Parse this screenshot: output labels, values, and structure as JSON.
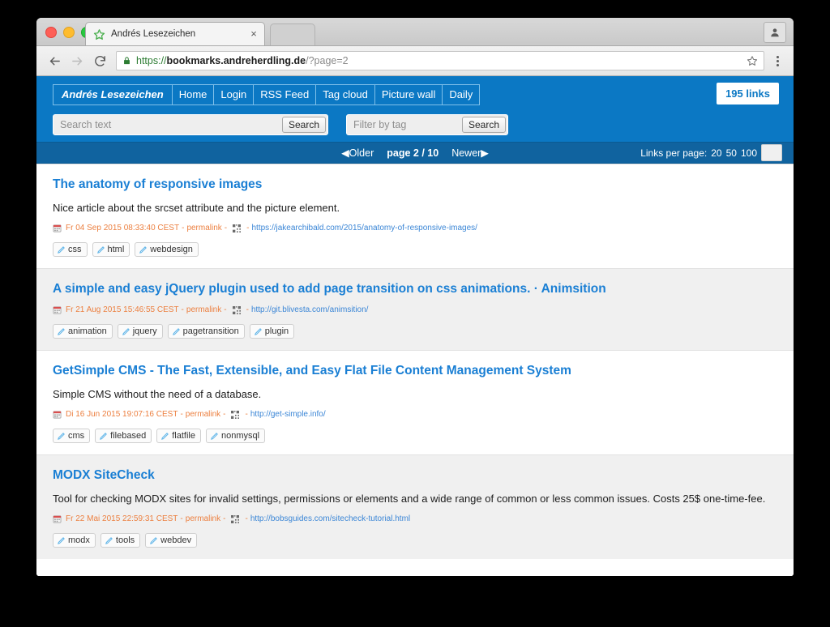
{
  "browser": {
    "tab_title": "Andrés Lesezeichen",
    "tab_close_label": "×",
    "url": {
      "scheme": "https://",
      "host": "bookmarks.andreherdling.de",
      "path": "/?page=2"
    }
  },
  "site": {
    "brand": "Andrés Lesezeichen",
    "menu": [
      {
        "label": "Home"
      },
      {
        "label": "Login"
      },
      {
        "label": "RSS Feed"
      },
      {
        "label": "Tag cloud"
      },
      {
        "label": "Picture wall"
      },
      {
        "label": "Daily"
      }
    ],
    "links_badge": "195 links",
    "search_text": {
      "value": "",
      "placeholder": "Search text",
      "button": "Search"
    },
    "search_tag": {
      "value": "",
      "placeholder": "Filter by tag",
      "button": "Search"
    },
    "accent_color": "#0b78c4",
    "paginator_color": "#10639f"
  },
  "paginator": {
    "older": "◀Older",
    "current": "page 2 / 10",
    "newer": "Newer▶",
    "per_page_label": "Links per page:",
    "per_page_options": [
      "20",
      "50",
      "100"
    ],
    "per_page_value": ""
  },
  "entries": [
    {
      "title": "The anatomy of responsive images",
      "description": "Nice article about the srcset attribute and the picture element.",
      "date": "Fr 04 Sep 2015 08:33:40 CEST",
      "permalink": "permalink",
      "url": "https://jakearchibald.com/2015/anatomy-of-responsive-images/",
      "tags": [
        "css",
        "html",
        "webdesign"
      ]
    },
    {
      "title": "A simple and easy jQuery plugin used to add page transition on css animations. · Animsition",
      "description": "",
      "date": "Fr 21 Aug 2015 15:46:55 CEST",
      "permalink": "permalink",
      "url": "http://git.blivesta.com/animsition/",
      "tags": [
        "animation",
        "jquery",
        "pagetransition",
        "plugin"
      ]
    },
    {
      "title": "GetSimple CMS - The Fast, Extensible, and Easy Flat File Content Management System",
      "description": "Simple CMS without the need of a database.",
      "date": "Di 16 Jun 2015 19:07:16 CEST",
      "permalink": "permalink",
      "url": "http://get-simple.info/",
      "tags": [
        "cms",
        "filebased",
        "flatfile",
        "nonmysql"
      ]
    },
    {
      "title": "MODX SiteCheck",
      "description": "Tool for checking MODX sites for invalid settings, permissions or elements and a wide range of common or less common issues. Costs 25$ one-time-fee.",
      "date": "Fr 22 Mai 2015 22:59:31 CEST",
      "permalink": "permalink",
      "url": "http://bobsguides.com/sitecheck-tutorial.html",
      "tags": [
        "modx",
        "tools",
        "webdev"
      ]
    }
  ]
}
